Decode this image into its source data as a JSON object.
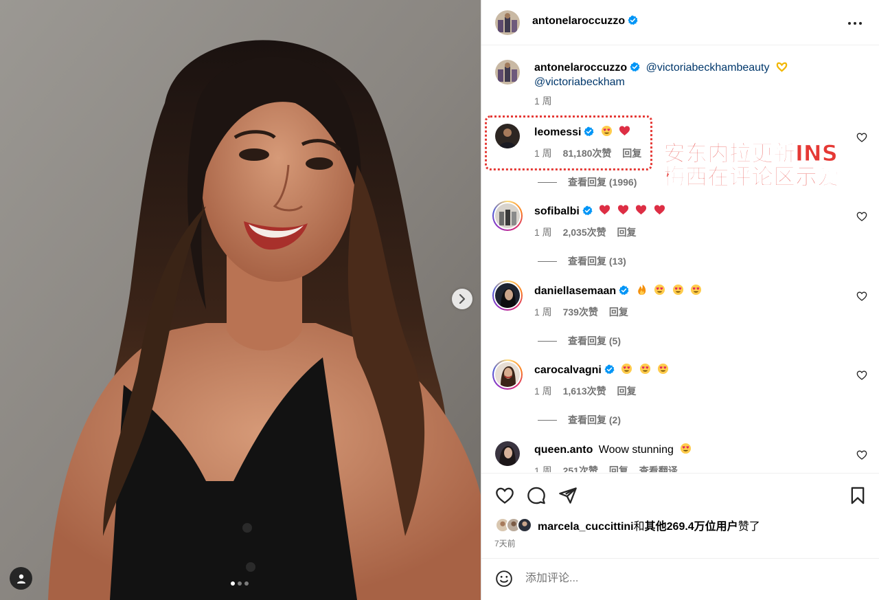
{
  "post": {
    "author": "antonelaroccuzzo",
    "carousel": {
      "total": 3,
      "active": 1
    }
  },
  "caption": {
    "username": "antonelaroccuzzo",
    "mention1": "@victoriabeckhambeauty",
    "mention2": "@victoriabeckham",
    "time": "1 周"
  },
  "comments": [
    {
      "username": "leomessi",
      "text": "",
      "time": "1 周",
      "likes": "81,180次赞",
      "reply": "回复",
      "view_replies": "查看回复 (1996)"
    },
    {
      "username": "sofibalbi",
      "text": "",
      "time": "1 周",
      "likes": "2,035次赞",
      "reply": "回复",
      "view_replies": "查看回复 (13)"
    },
    {
      "username": "daniellasemaan",
      "text": "",
      "time": "1 周",
      "likes": "739次赞",
      "reply": "回复",
      "view_replies": "查看回复 (5)"
    },
    {
      "username": "carocalvagni",
      "text": "",
      "time": "1 周",
      "likes": "1,613次赞",
      "reply": "回复",
      "view_replies": "查看回复 (2)"
    },
    {
      "username": "queen.anto",
      "text": "Woow stunning",
      "time": "1 周",
      "likes": "251次赞",
      "reply": "回复",
      "translate": "查看翻译"
    }
  ],
  "overlay": {
    "line1": "安东内拉更新INS",
    "line2": "梅西在评论区示爱",
    "color": "#e53935"
  },
  "likes_summary": {
    "user": "marcela_cuccittini",
    "connector": "和",
    "others": "其他269.4万位用户",
    "suffix": "赞了"
  },
  "posted_ago": "7天前",
  "composer": {
    "placeholder": "添加评论..."
  },
  "icons": [
    "more-options-icon",
    "verified-badge-icon",
    "heart-icon",
    "comment-icon",
    "share-icon",
    "bookmark-icon",
    "emoji-icon",
    "chevron-right-icon",
    "user-tag-icon"
  ],
  "colors": {
    "verified": "#0095f6",
    "link": "#00376b",
    "secondary_text": "#737373",
    "heart_red": "#ed3737"
  }
}
